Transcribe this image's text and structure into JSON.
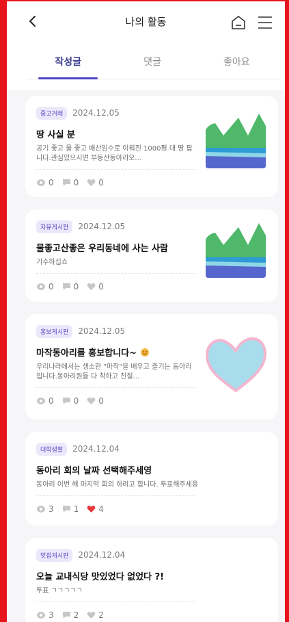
{
  "header": {
    "title": "나의 활동",
    "back_icon": "chevron-left-icon",
    "home_icon": "home-icon",
    "menu_icon": "hamburger-menu-icon"
  },
  "tabs": [
    {
      "label": "작성글",
      "active": true
    },
    {
      "label": "댓글",
      "active": false
    },
    {
      "label": "좋아요",
      "active": false
    }
  ],
  "posts": [
    {
      "category": "중고거래",
      "date": "2024.12.05",
      "title": "땅 사실 분",
      "body": "공기 좋고 물 좋고 배산임수로 이뤄진 1000평 대 땅 팝니다.관심있으시면 부동산동아리오...",
      "views": "0",
      "comments": "0",
      "likes": "0",
      "liked": false,
      "thumbnail": "landscape-graph"
    },
    {
      "category": "자유게시판",
      "date": "2024.12.05",
      "title": "물좋고산좋은 우리동네에 사는 사람",
      "body": "기수하십쇼",
      "views": "0",
      "comments": "0",
      "likes": "0",
      "liked": false,
      "thumbnail": "landscape-graph"
    },
    {
      "category": "홍보게시판",
      "date": "2024.12.05",
      "title": "마작동아리를 홍보합니다~",
      "body": "우리나라에서는 생소한 \"마작\"을 배우고 즐기는 동아리입니다.동아리원들 다 착하고 친절...",
      "views": "0",
      "comments": "0",
      "likes": "0",
      "liked": false,
      "thumbnail": "heart-drawing"
    },
    {
      "category": "대학생활",
      "date": "2024.12.04",
      "title": "동아리 회의 날짜 선택해주세영",
      "body": "동아리 이번 해 마지막 회의 하려고 합니다. 투표해주세용",
      "views": "3",
      "comments": "1",
      "likes": "4",
      "liked": true,
      "thumbnail": ""
    },
    {
      "category": "맛집게시판",
      "date": "2024.12.04",
      "title": "오늘 교내식당 맛있었다 없었다 ?!",
      "body": "투표 ㄱㄱㄱㄱㄱ",
      "views": "3",
      "comments": "2",
      "likes": "2",
      "liked": false,
      "thumbnail": ""
    }
  ],
  "colors": {
    "accent": "#4a46c4",
    "badge_bg": "#ece8fb",
    "badge_text": "#5b4bc7",
    "like_active": "#e5383b",
    "stat_icon": "#c7c7c7",
    "frame": "#e8141c"
  }
}
